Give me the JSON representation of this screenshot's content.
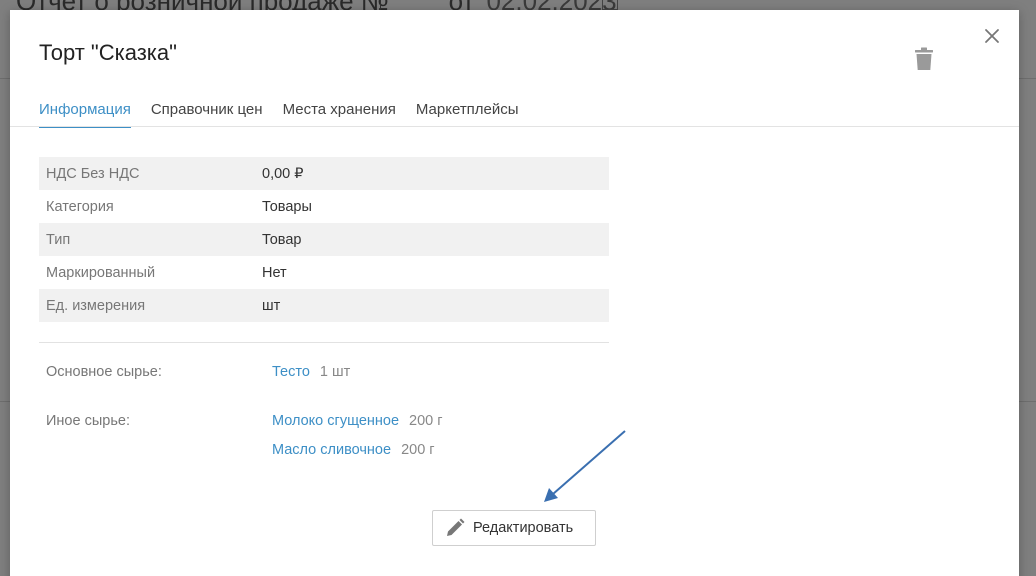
{
  "background": {
    "title": "Отчет о розничной продаже №",
    "from_label": "от",
    "date": "02.02.2023"
  },
  "modal": {
    "title": "Торт \"Сказка\"",
    "tabs": [
      {
        "label": "Информация",
        "active": true
      },
      {
        "label": "Справочник цен",
        "active": false
      },
      {
        "label": "Места хранения",
        "active": false
      },
      {
        "label": "Маркетплейсы",
        "active": false
      }
    ],
    "properties": [
      {
        "label": "НДС Без НДС",
        "value": "0,00 ₽"
      },
      {
        "label": "Категория",
        "value": "Товары"
      },
      {
        "label": "Тип",
        "value": "Товар"
      },
      {
        "label": "Маркированный",
        "value": "Нет"
      },
      {
        "label": "Ед. измерения",
        "value": "шт"
      }
    ],
    "main_raw": {
      "label": "Основное сырье:",
      "items": [
        {
          "name": "Тесто",
          "qty": "1 шт"
        }
      ]
    },
    "other_raw": {
      "label": "Иное сырье:",
      "items": [
        {
          "name": "Молоко сгущенное",
          "qty": "200 г"
        },
        {
          "name": "Масло сливочное",
          "qty": "200 г"
        }
      ]
    },
    "edit_button": "Редактировать"
  },
  "colors": {
    "accent": "#3d8fc6",
    "annotation_arrow": "#3a6fb0",
    "overlay": "#7f7f7f"
  },
  "icons": {
    "close": "close-icon",
    "trash": "trash-icon",
    "edit": "pencil-icon"
  }
}
